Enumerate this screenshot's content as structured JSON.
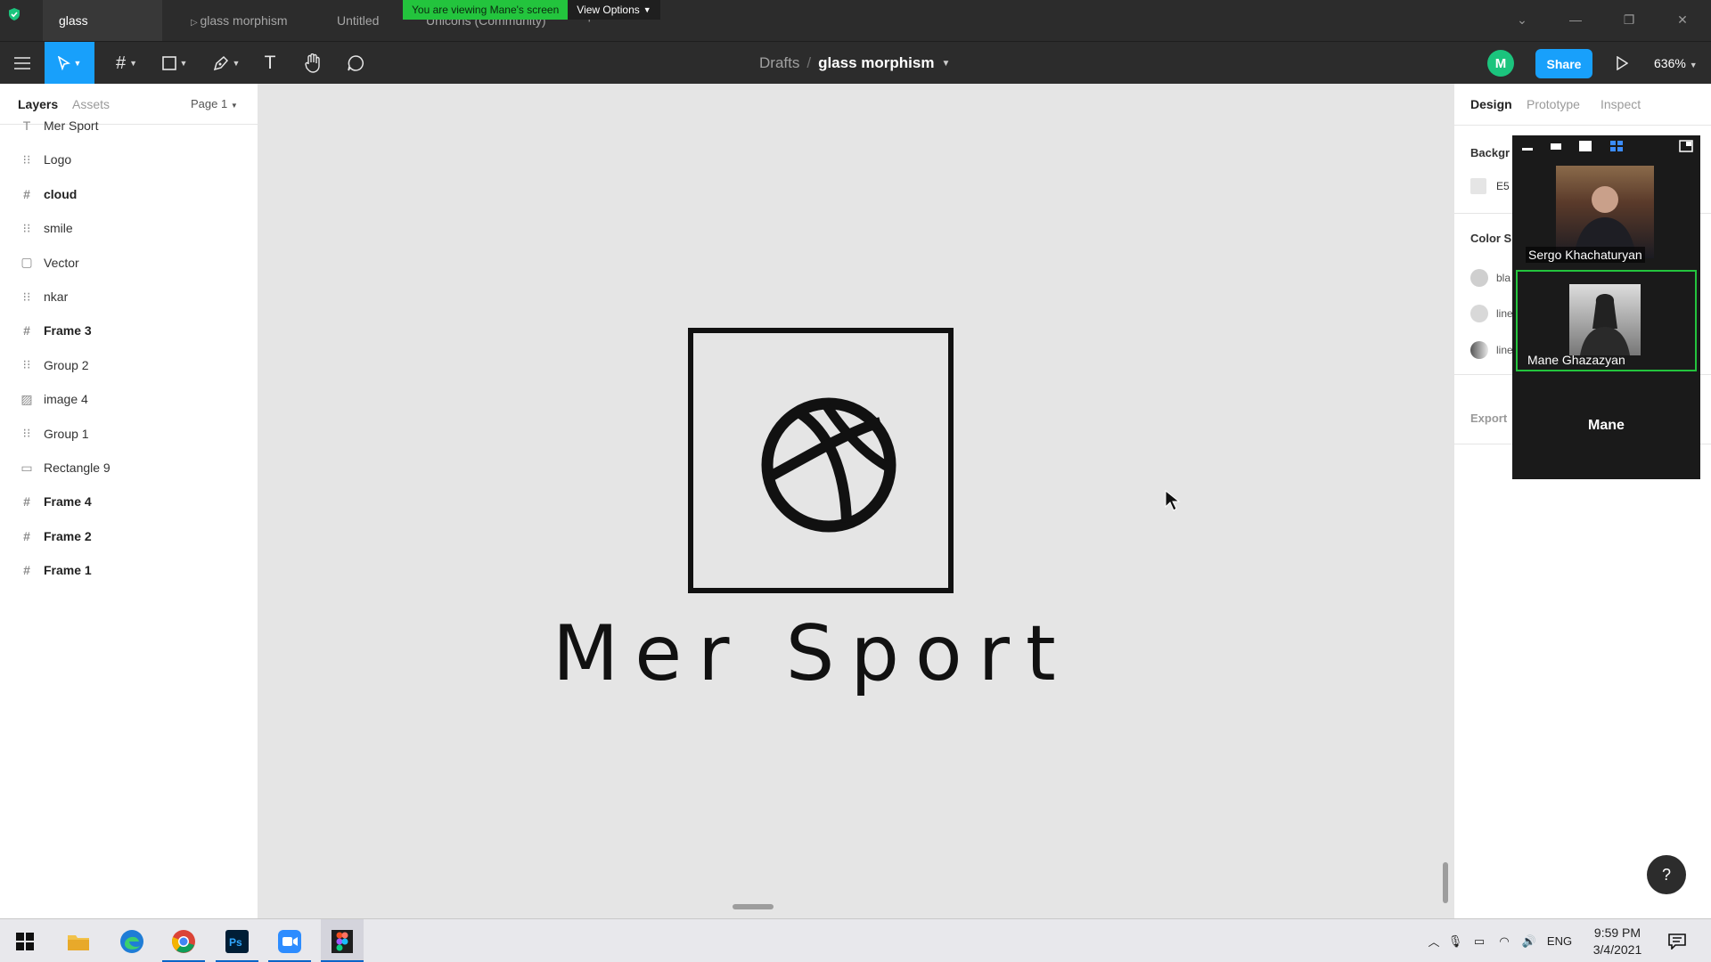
{
  "tabs": [
    {
      "label": "glass morphism"
    },
    {
      "label": "glass morphism"
    },
    {
      "label": "Untitled"
    },
    {
      "label": "Unicons (Community)"
    }
  ],
  "screenshare": {
    "notice": "You are viewing Mane's screen",
    "view_options": "View Options"
  },
  "toolbar": {
    "breadcrumb_parent": "Drafts",
    "breadcrumb_sep": "/",
    "file_name": "glass morphism",
    "avatar_initial": "M",
    "share_label": "Share",
    "zoom": "636%"
  },
  "left_panel": {
    "tabs": [
      "Layers",
      "Assets"
    ],
    "page": "Page 1",
    "layers": [
      {
        "name": "Mer Sport",
        "icon": "text-icon",
        "bold": false
      },
      {
        "name": "Logo",
        "icon": "group-icon",
        "bold": false
      },
      {
        "name": "cloud",
        "icon": "frame-icon",
        "bold": true
      },
      {
        "name": "smile",
        "icon": "group-icon",
        "bold": false
      },
      {
        "name": "Vector",
        "icon": "vector-icon",
        "bold": false
      },
      {
        "name": "nkar",
        "icon": "group-icon",
        "bold": false
      },
      {
        "name": "Frame 3",
        "icon": "frame-icon",
        "bold": true
      },
      {
        "name": "Group 2",
        "icon": "group-icon",
        "bold": false
      },
      {
        "name": "image 4",
        "icon": "image-icon",
        "bold": false
      },
      {
        "name": "Group 1",
        "icon": "group-icon",
        "bold": false
      },
      {
        "name": "Rectangle 9",
        "icon": "rectangle-icon",
        "bold": false
      },
      {
        "name": "Frame 4",
        "icon": "frame-icon",
        "bold": true
      },
      {
        "name": "Frame 2",
        "icon": "frame-icon",
        "bold": true
      },
      {
        "name": "Frame 1",
        "icon": "frame-icon",
        "bold": true
      }
    ]
  },
  "canvas": {
    "logo_text": "Mer Sport"
  },
  "right_panel": {
    "tabs": [
      "Design",
      "Prototype",
      "Inspect"
    ],
    "background_title": "Backgr",
    "background_value": "E5",
    "color_styles_title": "Color S",
    "styles": [
      "bla",
      "line",
      "line"
    ],
    "export_title": "Export"
  },
  "video": {
    "participants": [
      {
        "name": "Sergo Khachaturyan"
      },
      {
        "name": "Mane Ghazazyan"
      }
    ],
    "self_name": "Mane"
  },
  "taskbar": {
    "lang": "ENG",
    "time": "9:59 PM",
    "date": "3/4/2021"
  },
  "colors": {
    "accent": "#18a0fb",
    "share_green": "#23c43d",
    "avatar": "#1bc47d"
  }
}
